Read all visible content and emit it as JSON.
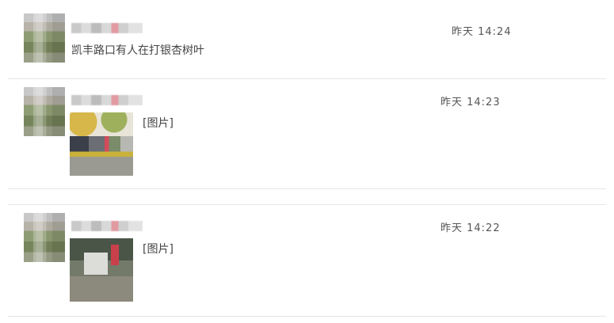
{
  "messages": [
    {
      "time": "昨天 14:24",
      "text": "凯丰路口有人在打银杏树叶"
    },
    {
      "time": "昨天 14:23",
      "text": "[图片]"
    },
    {
      "time": "昨天 14:22",
      "text": "[图片]"
    }
  ]
}
